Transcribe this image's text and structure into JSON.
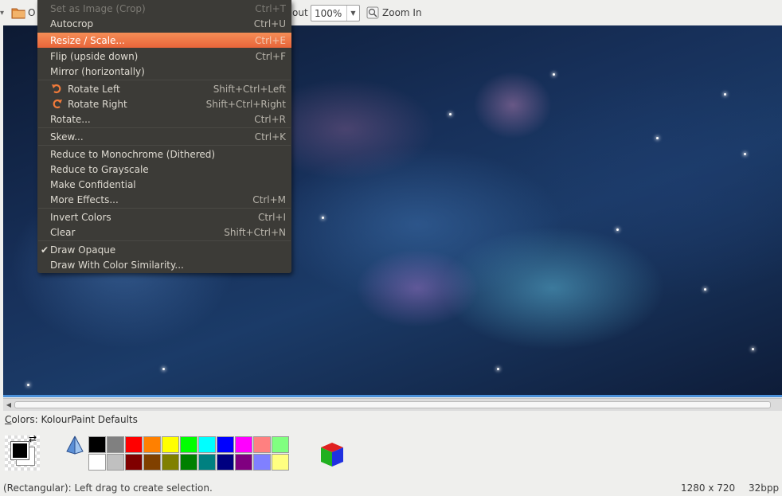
{
  "toolbar": {
    "open_label_partial": "O",
    "zoom_out_partial": "out",
    "zoom_value": "100%",
    "zoom_in_label": "Zoom In"
  },
  "menu": {
    "items": [
      {
        "label": "Set as Image (Crop)",
        "shortcut": "Ctrl+T",
        "disabled": true
      },
      {
        "label": "Autocrop",
        "shortcut": "Ctrl+U"
      },
      {
        "label": "Resize / Scale...",
        "shortcut": "Ctrl+E",
        "highlighted": true
      },
      {
        "label": "Flip (upside down)",
        "shortcut": "Ctrl+F"
      },
      {
        "label": "Mirror (horizontally)",
        "shortcut": ""
      },
      {
        "label": "Rotate Left",
        "shortcut": "Shift+Ctrl+Left",
        "icon": "rotate-left-icon"
      },
      {
        "label": "Rotate Right",
        "shortcut": "Shift+Ctrl+Right",
        "icon": "rotate-right-icon"
      },
      {
        "label": "Rotate...",
        "shortcut": "Ctrl+R"
      },
      {
        "label": "Skew...",
        "shortcut": "Ctrl+K"
      },
      {
        "label": "Reduce to Monochrome (Dithered)",
        "shortcut": ""
      },
      {
        "label": "Reduce to Grayscale",
        "shortcut": ""
      },
      {
        "label": "Make Confidential",
        "shortcut": ""
      },
      {
        "label": "More Effects...",
        "shortcut": "Ctrl+M"
      },
      {
        "label": "Invert Colors",
        "shortcut": "Ctrl+I"
      },
      {
        "label": "Clear",
        "shortcut": "Shift+Ctrl+N"
      },
      {
        "label": "Draw Opaque",
        "shortcut": "",
        "checked": true
      },
      {
        "label": "Draw With Color Similarity...",
        "shortcut": ""
      }
    ]
  },
  "colors": {
    "label_prefix": "C",
    "label_rest": "olors: KolourPaint Defaults",
    "foreground": "#000000",
    "background": "#ffffff",
    "palette_top": [
      "#000000",
      "#808080",
      "#ff0000",
      "#ff8000",
      "#ffff00",
      "#00ff00",
      "#00ffff",
      "#0000ff",
      "#ff00ff",
      "#ff8080",
      "#80ff80"
    ],
    "palette_bottom": [
      "#ffffff",
      "#c0c0c0",
      "#800000",
      "#804000",
      "#808000",
      "#008000",
      "#008080",
      "#000080",
      "#800080",
      "#8080ff",
      "#ffff80"
    ]
  },
  "status": {
    "message": "(Rectangular): Left drag to create selection.",
    "image_size": "1280 x 720",
    "bpp": "32bpp"
  }
}
